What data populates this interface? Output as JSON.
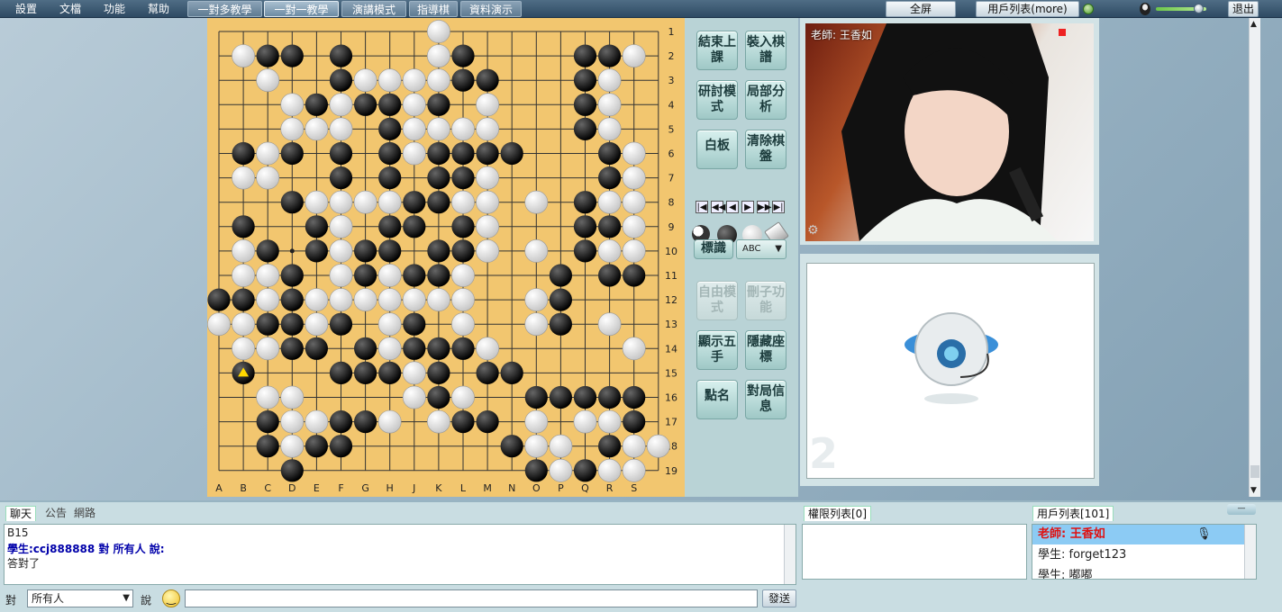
{
  "menu": [
    "設置",
    "文檔",
    "功能",
    "幫助"
  ],
  "modes": [
    "一對多教學",
    "一對一教學",
    "演講模式",
    "指導棋",
    "資料演示"
  ],
  "active_mode": 1,
  "top_buttons": {
    "fullscreen": "全屏",
    "user_list_more": "用戶列表(more)",
    "exit": "退出"
  },
  "board": {
    "columns": [
      "A",
      "B",
      "C",
      "D",
      "E",
      "F",
      "G",
      "H",
      "J",
      "K",
      "L",
      "M",
      "N",
      "O",
      "P",
      "Q",
      "R",
      "S"
    ],
    "rows": [
      "1",
      "2",
      "3",
      "4",
      "5",
      "6",
      "7",
      "8",
      "9",
      "10",
      "11",
      "12",
      "13",
      "14",
      "15",
      "16",
      "17",
      "18",
      "19"
    ],
    "board_size": 19,
    "black_stones": [
      [
        3,
        2
      ],
      [
        4,
        2
      ],
      [
        6,
        2
      ],
      [
        10,
        2
      ],
      [
        11,
        2
      ],
      [
        16,
        2
      ],
      [
        17,
        2
      ],
      [
        6,
        3
      ],
      [
        11,
        3
      ],
      [
        12,
        3
      ],
      [
        16,
        3
      ],
      [
        5,
        4
      ],
      [
        7,
        4
      ],
      [
        8,
        4
      ],
      [
        10,
        4
      ],
      [
        16,
        4
      ],
      [
        8,
        5
      ],
      [
        16,
        5
      ],
      [
        2,
        6
      ],
      [
        4,
        6
      ],
      [
        6,
        6
      ],
      [
        8,
        6
      ],
      [
        10,
        6
      ],
      [
        11,
        6
      ],
      [
        12,
        6
      ],
      [
        13,
        6
      ],
      [
        17,
        6
      ],
      [
        6,
        7
      ],
      [
        8,
        7
      ],
      [
        10,
        7
      ],
      [
        11,
        7
      ],
      [
        17,
        7
      ],
      [
        4,
        8
      ],
      [
        9,
        8
      ],
      [
        10,
        8
      ],
      [
        16,
        8
      ],
      [
        2,
        9
      ],
      [
        5,
        9
      ],
      [
        8,
        9
      ],
      [
        9,
        9
      ],
      [
        11,
        9
      ],
      [
        16,
        9
      ],
      [
        17,
        9
      ],
      [
        3,
        10
      ],
      [
        5,
        10
      ],
      [
        7,
        10
      ],
      [
        8,
        10
      ],
      [
        10,
        10
      ],
      [
        11,
        10
      ],
      [
        16,
        10
      ],
      [
        4,
        11
      ],
      [
        7,
        11
      ],
      [
        9,
        11
      ],
      [
        10,
        11
      ],
      [
        15,
        11
      ],
      [
        17,
        11
      ],
      [
        18,
        11
      ],
      [
        1,
        12
      ],
      [
        2,
        12
      ],
      [
        4,
        12
      ],
      [
        15,
        12
      ],
      [
        3,
        13
      ],
      [
        4,
        13
      ],
      [
        6,
        13
      ],
      [
        9,
        13
      ],
      [
        15,
        13
      ],
      [
        4,
        14
      ],
      [
        5,
        14
      ],
      [
        7,
        14
      ],
      [
        9,
        14
      ],
      [
        10,
        14
      ],
      [
        11,
        14
      ],
      [
        2,
        15
      ],
      [
        6,
        15
      ],
      [
        7,
        15
      ],
      [
        8,
        15
      ],
      [
        10,
        15
      ],
      [
        12,
        15
      ],
      [
        13,
        15
      ],
      [
        10,
        16
      ],
      [
        14,
        16
      ],
      [
        15,
        16
      ],
      [
        16,
        16
      ],
      [
        17,
        16
      ],
      [
        18,
        16
      ],
      [
        3,
        17
      ],
      [
        6,
        17
      ],
      [
        7,
        17
      ],
      [
        11,
        17
      ],
      [
        12,
        17
      ],
      [
        18,
        17
      ],
      [
        3,
        18
      ],
      [
        5,
        18
      ],
      [
        6,
        18
      ],
      [
        13,
        18
      ],
      [
        17,
        18
      ],
      [
        4,
        19
      ],
      [
        14,
        19
      ],
      [
        16,
        19
      ]
    ],
    "white_stones": [
      [
        10,
        1
      ],
      [
        2,
        2
      ],
      [
        10,
        2
      ],
      [
        18,
        2
      ],
      [
        3,
        3
      ],
      [
        7,
        3
      ],
      [
        8,
        3
      ],
      [
        9,
        3
      ],
      [
        10,
        3
      ],
      [
        17,
        3
      ],
      [
        4,
        4
      ],
      [
        6,
        4
      ],
      [
        9,
        4
      ],
      [
        12,
        4
      ],
      [
        17,
        4
      ],
      [
        4,
        5
      ],
      [
        5,
        5
      ],
      [
        6,
        5
      ],
      [
        9,
        5
      ],
      [
        10,
        5
      ],
      [
        11,
        5
      ],
      [
        12,
        5
      ],
      [
        17,
        5
      ],
      [
        3,
        6
      ],
      [
        9,
        6
      ],
      [
        18,
        6
      ],
      [
        2,
        7
      ],
      [
        3,
        7
      ],
      [
        12,
        7
      ],
      [
        18,
        7
      ],
      [
        5,
        8
      ],
      [
        6,
        8
      ],
      [
        7,
        8
      ],
      [
        8,
        8
      ],
      [
        11,
        8
      ],
      [
        12,
        8
      ],
      [
        14,
        8
      ],
      [
        17,
        8
      ],
      [
        18,
        8
      ],
      [
        6,
        9
      ],
      [
        12,
        9
      ],
      [
        18,
        9
      ],
      [
        2,
        10
      ],
      [
        6,
        10
      ],
      [
        12,
        10
      ],
      [
        14,
        10
      ],
      [
        17,
        10
      ],
      [
        18,
        10
      ],
      [
        2,
        11
      ],
      [
        3,
        11
      ],
      [
        6,
        11
      ],
      [
        8,
        11
      ],
      [
        11,
        11
      ],
      [
        3,
        12
      ],
      [
        5,
        12
      ],
      [
        6,
        12
      ],
      [
        7,
        12
      ],
      [
        8,
        12
      ],
      [
        9,
        12
      ],
      [
        10,
        12
      ],
      [
        11,
        12
      ],
      [
        14,
        12
      ],
      [
        1,
        13
      ],
      [
        2,
        13
      ],
      [
        5,
        13
      ],
      [
        8,
        13
      ],
      [
        11,
        13
      ],
      [
        14,
        13
      ],
      [
        17,
        13
      ],
      [
        2,
        14
      ],
      [
        3,
        14
      ],
      [
        8,
        14
      ],
      [
        12,
        14
      ],
      [
        18,
        14
      ],
      [
        9,
        15
      ],
      [
        3,
        16
      ],
      [
        4,
        16
      ],
      [
        9,
        16
      ],
      [
        11,
        16
      ],
      [
        4,
        17
      ],
      [
        5,
        17
      ],
      [
        8,
        17
      ],
      [
        10,
        17
      ],
      [
        14,
        17
      ],
      [
        16,
        17
      ],
      [
        17,
        17
      ],
      [
        4,
        18
      ],
      [
        14,
        18
      ],
      [
        15,
        18
      ],
      [
        18,
        18
      ],
      [
        19,
        18
      ],
      [
        15,
        19
      ],
      [
        17,
        19
      ],
      [
        18,
        19
      ]
    ],
    "last_move": [
      2,
      15
    ]
  },
  "controls": {
    "end_class": "結束上課",
    "load_record": "裝入棋譜",
    "study_mode": "研討模式",
    "local_analysis": "局部分析",
    "whiteboard": "白板",
    "clear_board": "清除棋盤",
    "mark": "標識",
    "mark_type": "ABC",
    "free_mode": "自由模式",
    "remove_stone": "刪子功能",
    "show_five": "顯示五手",
    "hide_coords": "隱藏座標",
    "roll_call": "點名",
    "game_info": "對局信息"
  },
  "video": {
    "teacher_label": "老師: 王香如",
    "cam_number": "2"
  },
  "tabs": {
    "chat": "聊天",
    "notice": "公告",
    "network": "網路"
  },
  "chat": {
    "line1": "B15",
    "line2": "學生:ccj888888 對 所有人 說:",
    "line3": "答對了"
  },
  "auth_list": {
    "title": "權限列表[0]"
  },
  "user_list": {
    "title": "用戶列表[101]",
    "users": [
      "老師: 王香如",
      "學生: forget123",
      "學生: 嘟嘟"
    ]
  },
  "composer": {
    "to_label": "對",
    "recipient": "所有人",
    "say_label": "說",
    "send": "發送"
  },
  "colors": {
    "board": "#f2c66f",
    "topbar": "#2e4a63",
    "highlight": "#8ccbf4",
    "teacher_red": "#e01010"
  }
}
